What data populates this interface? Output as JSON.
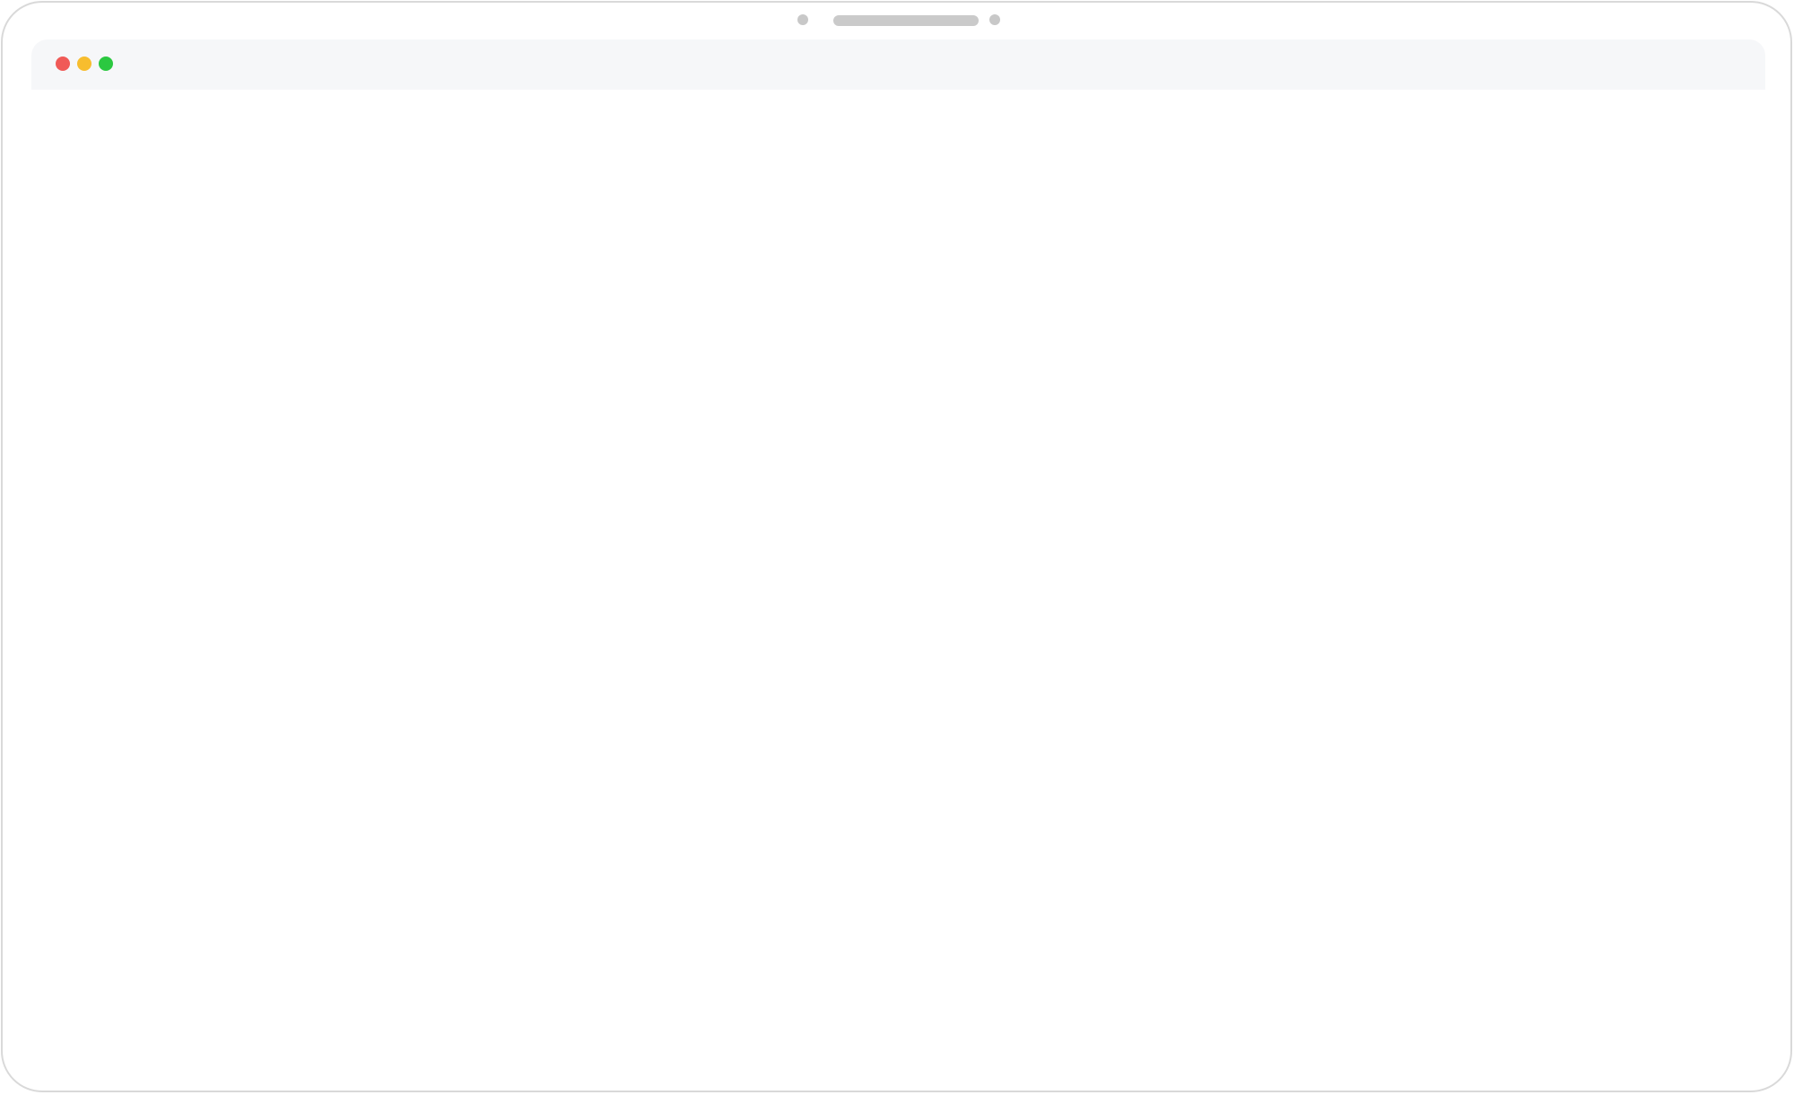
{
  "window": {
    "title": "",
    "controls": {
      "close": {
        "icon": "close-dot-icon",
        "color": "#f05a57"
      },
      "minimize": {
        "icon": "minimize-dot-icon",
        "color": "#f7bd2e"
      },
      "zoom": {
        "icon": "zoom-dot-icon",
        "color": "#2bc840"
      }
    }
  },
  "content": {
    "text": ""
  }
}
